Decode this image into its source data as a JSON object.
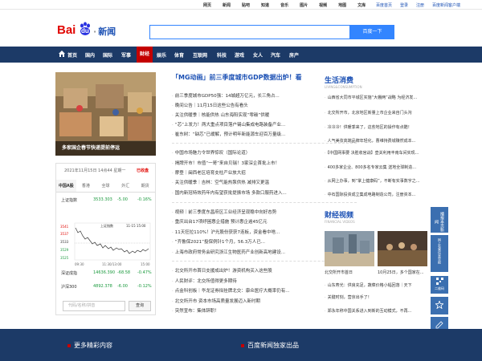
{
  "topbar": {
    "links": [
      "网页",
      "新闻",
      "贴吧",
      "知道",
      "音乐",
      "图片",
      "视频",
      "地图",
      "文库"
    ],
    "right": [
      "百度首页",
      "登录",
      "注册",
      "百度新闻客户端"
    ]
  },
  "logo": {
    "bai": "Bai",
    "du": "du",
    "news": "新闻"
  },
  "search": {
    "value": "",
    "button": "百度一下"
  },
  "nav": {
    "items": [
      "首页",
      "国内",
      "国际",
      "军事",
      "财经",
      "娱乐",
      "体育",
      "互联网",
      "科技",
      "游戏",
      "女人",
      "汽车",
      "房产"
    ],
    "active": "财经"
  },
  "feature": {
    "caption": "多家国企春节快递提前停运"
  },
  "stock": {
    "date": "2021年11月15日 14点44 星期一",
    "status": "已收盘",
    "tabs": [
      "中国A股",
      "香港",
      "全球",
      "外汇",
      "期货"
    ],
    "rows_top": [
      {
        "name": "上证指数",
        "value": "3533.303",
        "change": "-5.00",
        "pct": "-0.16%"
      }
    ],
    "chart_title": "上证指数",
    "chart_time": "11-15 15:00",
    "chart_yticks": [
      "3541",
      "3537",
      "3533",
      "3529",
      "3525"
    ],
    "chart_xticks": [
      "09:30",
      "11:30/13:00",
      "15:00"
    ],
    "rows_bottom": [
      {
        "name": "深证成指",
        "value": "14636.390",
        "change": "-68.58",
        "pct": "-0.47%"
      },
      {
        "name": "沪深300",
        "value": "4892.378",
        "change": "-6.00",
        "pct": "-0.12%"
      }
    ],
    "code_placeholder": "代码/名称/拼音",
    "query": "查询"
  },
  "main": {
    "headline": "「MG动画」前三季度城市GDP数据出炉！看",
    "group1": [
      "前三季度城市GDP50强：14城超万亿元，长三角占...",
      "晚间公告｜11月15日这些公告有看头",
      "关注供暖季｜核能供热 山东海阳实现“零碳”供暖",
      "“芯”上发力！两大重点项目落户锡山集成电路装备产业...",
      "崔东树：“缺芯”已缓解，预计明年新能源车迎百万量级..."
    ],
    "group2": [
      "中国市场魅力令世界惊叹（国际论道）",
      "揭牌开市！市值“一哥”来自贝瑞！3家深企首批上市！",
      "摩登｜闽西老区培育支柱产业放大招",
      "关注供暖季｜吉林：空气能热泵供热 减排又更温",
      "国内新冠特效药年内有望获批提振市场 多款口服药进入..."
    ],
    "group3": [
      "视频｜前三季度东昌府区工业经济呈现稳中向好态势",
      "重庆出台17项纾困惠企措施 预计惠企逾45亿元",
      "11天狂拉110%！沪光股份获获7连板，资金看中啥...",
      "“齐鲁保2021”投保例针1个月，56.3万人已...",
      "上海市政府常务会研究浙江生物医药产业创新高地建设..."
    ],
    "group4": [
      "北交所开市首日支援成出炉！游资机构买入这些股",
      "人民财评：北交所值得更多期待",
      "点金科创板｜华龙证券拟挂牌北交：康众医疗大概率仍有...",
      "北交所开市 资本市场高质量发展迈入新时期",
      "突然宣布：集体辞职！"
    ]
  },
  "right": {
    "section1_title": "生活消费",
    "section1_sub": "LIVING&CONSUMPTION",
    "section1_items": [
      "山西省大同市平城区实施“大棚两”战略 为经济发...",
      "北交所开市，北京地区新量上市企业来自门头沟",
      "冷冷冷！供暖季来了，这些地区的操作有点酷！",
      "人气美妆高端品牌年轻化，曹维持费城赚然成本...",
      "【中国网事要 决胜收官战】壶关利用丰南车间实现...",
      "400多家企业、800多名专家云集 送地全球制造...",
      "从网上办事，到“掌上健康码”，不断有实事数字之...",
      "中石国际投资成立集成电路制造公司，注册资本..."
    ],
    "section2_title": "财经视频",
    "section2_sub": "FINANCIAL VIDEOS",
    "thumbs": [
      "北交所开市首日",
      "10月25日，多个国家在..."
    ],
    "section2_items": [
      "山东寿光：供良充足，蔬菜价格小幅回落｜天下",
      "关键时刻，营京出手了！",
      "郑永年称中国关系进入到新的互动模式，不再..."
    ]
  },
  "sidebar": [
    "播报本页新闻",
    "网上有害信息举报",
    "二维码",
    "收藏",
    "反馈"
  ],
  "footer": {
    "left": "更多精彩内容",
    "right": "百度新闻独家出品"
  }
}
